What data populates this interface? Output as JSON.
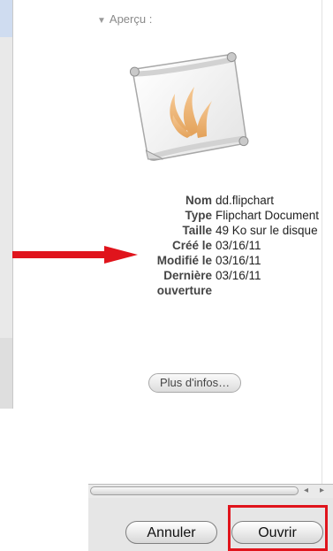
{
  "preview": {
    "header": "Aperçu :"
  },
  "info": [
    {
      "key": "Nom",
      "value": "dd.flipchart"
    },
    {
      "key": "Type",
      "value": "Flipchart Document"
    },
    {
      "key": "Taille",
      "value": "49 Ko sur le disque"
    },
    {
      "key": "Créé le",
      "value": "03/16/11"
    },
    {
      "key": "Modifié le",
      "value": "03/16/11"
    },
    {
      "key": "Dernière ouverture",
      "value": "03/16/11"
    }
  ],
  "buttons": {
    "more_info": "Plus d'infos…",
    "cancel": "Annuler",
    "open": "Ouvrir"
  },
  "icons": {
    "preview_toggle": "disclosure-triangle-down",
    "document": "flipchart-document-icon"
  },
  "colors": {
    "annotation_red": "#e0141c"
  }
}
